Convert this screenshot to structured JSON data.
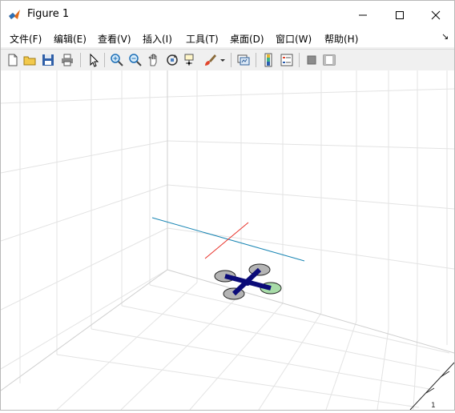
{
  "window": {
    "title": "Figure 1"
  },
  "menu": {
    "items": [
      "文件(F)",
      "编辑(E)",
      "查看(V)",
      "插入(I)",
      "工具(T)",
      "桌面(D)",
      "窗口(W)",
      "帮助(H)"
    ]
  },
  "toolbar": {
    "buttons": [
      "new-figure-icon",
      "open-icon",
      "save-icon",
      "print-icon",
      "select-arrow-icon",
      "zoom-in-icon",
      "zoom-out-icon",
      "pan-hand-icon",
      "rotate-3d-icon",
      "data-cursor-icon",
      "brush-icon",
      "link-plot-icon",
      "colorbar-icon",
      "legend-icon",
      "hide-plot-tools-icon",
      "show-plot-tools-icon"
    ]
  },
  "axes": {
    "corner_tick_label": "1"
  },
  "colors": {
    "grid": "#e3e3e3",
    "axis": "#262626",
    "quad_body": "#0b0b78",
    "rotor": "#b4b4b4",
    "front_rotor": "#a8dca8",
    "line_cyan": "#1a86b4",
    "line_red": "#e8322a"
  }
}
